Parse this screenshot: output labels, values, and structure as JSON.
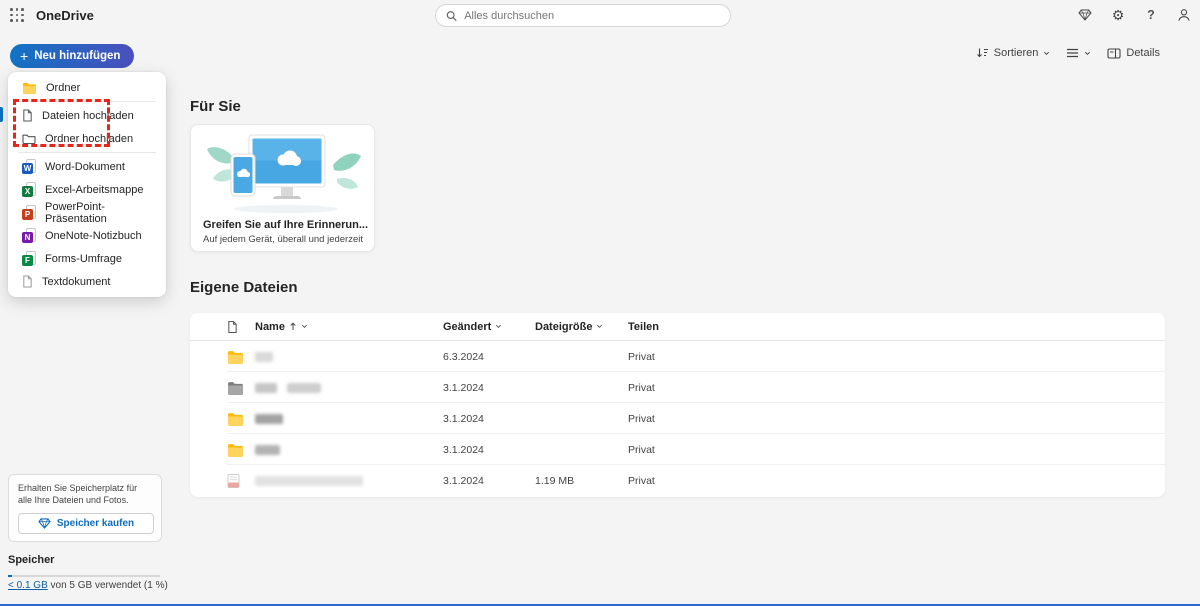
{
  "colors": {
    "accent_blue": "#0f6cbd",
    "button_gradient_start": "#1173c5",
    "button_gradient_end": "#4a50bb",
    "highlight_red": "#e8251c",
    "folder_yellow": "#ffb900",
    "page_background": "#f4f4f4"
  },
  "header": {
    "app_title": "OneDrive",
    "search_placeholder": "Alles durchsuchen",
    "icons": [
      "app-launcher",
      "premium-diamond",
      "settings-gear",
      "help",
      "account"
    ]
  },
  "toolbar": {
    "new_button_label": "Neu hinzufügen",
    "new_button_plus": "+",
    "sort_label": "Sortieren",
    "details_label": "Details"
  },
  "menu": {
    "items": [
      {
        "label": "Ordner",
        "icon": "folder-filled"
      },
      {
        "label": "Dateien hochladen",
        "icon": "file-upload"
      },
      {
        "label": "Ordner hochladen",
        "icon": "folder-upload"
      },
      {
        "label": "Word-Dokument",
        "icon": "word",
        "letter": "W",
        "color": "#185abd"
      },
      {
        "label": "Excel-Arbeitsmappe",
        "icon": "excel",
        "letter": "X",
        "color": "#107c41"
      },
      {
        "label": "PowerPoint-Präsentation",
        "icon": "powerpoint",
        "letter": "P",
        "color": "#c43e1c"
      },
      {
        "label": "OneNote-Notizbuch",
        "icon": "onenote",
        "letter": "N",
        "color": "#7719aa"
      },
      {
        "label": "Forms-Umfrage",
        "icon": "forms",
        "letter": "F",
        "color": "#0b8a47"
      },
      {
        "label": "Textdokument",
        "icon": "text-document"
      }
    ],
    "highlighted_items": [
      "Dateien hochladen",
      "Ordner hochladen"
    ]
  },
  "for_you": {
    "heading": "Für Sie",
    "card_title": "Greifen Sie auf Ihre Erinnerun...",
    "card_subtitle": "Auf jedem Gerät, überall und jederzeit"
  },
  "files": {
    "heading": "Eigene Dateien",
    "columns": {
      "name": "Name",
      "modified": "Geändert",
      "size": "Dateigröße",
      "share": "Teilen"
    },
    "sort": {
      "column": "Name",
      "direction": "ascending"
    },
    "rows": [
      {
        "icon": "folder-yellow",
        "name_redacted": true,
        "modified": "6.3.2024",
        "size": "",
        "share": "Privat"
      },
      {
        "icon": "folder-gray",
        "name_redacted": true,
        "modified": "3.1.2024",
        "size": "",
        "share": "Privat"
      },
      {
        "icon": "folder-yellow",
        "name_redacted": true,
        "modified": "3.1.2024",
        "size": "",
        "share": "Privat"
      },
      {
        "icon": "folder-yellow",
        "name_redacted": true,
        "modified": "3.1.2024",
        "size": "",
        "share": "Privat"
      },
      {
        "icon": "pdf-file",
        "name_redacted": true,
        "modified": "3.1.2024",
        "size": "1.19 MB",
        "share": "Privat"
      }
    ]
  },
  "storage": {
    "promo_text": "Erhalten Sie Speicherplatz für alle Ihre Dateien und Fotos.",
    "buy_button_label": "Speicher kaufen",
    "heading": "Speicher",
    "usage_link": "< 0.1 GB",
    "usage_text": "von 5 GB verwendet (1 %)",
    "usage_percent": 1
  }
}
